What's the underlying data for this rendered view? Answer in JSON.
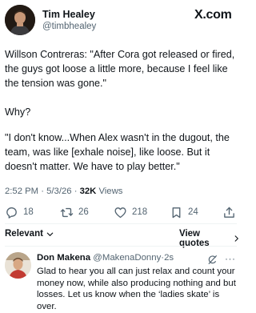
{
  "post": {
    "author_name": "Tim Healey",
    "author_handle": "@timbhealey",
    "platform_logo": "X.com",
    "paragraphs": [
      "Willson Contreras: \"After Cora got released or fired, the guys got loose a little more, because I feel like the tension was gone.\"",
      "Why?",
      "\"I don't know...When Alex wasn't in the dugout, the team, was like [exhale noise], like loose. But it doesn't matter. We have to play better.\""
    ],
    "time": "2:52 PM",
    "date": "5/3/26",
    "separator": "·",
    "views_count": "32K",
    "views_label": "Views"
  },
  "actions": {
    "replies": "18",
    "reposts": "26",
    "likes": "218",
    "bookmarks": "24"
  },
  "replies_bar": {
    "sort_label": "Relevant",
    "view_quotes_label": "View quotes"
  },
  "reply": {
    "name": "Don Makena",
    "handle": "@MakenaDonny",
    "separator": "·",
    "time": "2s",
    "text": "Glad to hear you all can just relax and count your money now, while also producing nothing and but losses.  Let us know when the ‘ladies skate’ is over.",
    "more_glyph": "···"
  },
  "icons": {
    "reply": "reply-icon",
    "repost": "repost-icon",
    "like": "heart-icon",
    "bookmark": "bookmark-icon",
    "share": "share-icon",
    "grok": "grok-icon"
  },
  "colors": {
    "text": "#0f1419",
    "secondary": "#536471",
    "divider": "#eff3f4"
  }
}
